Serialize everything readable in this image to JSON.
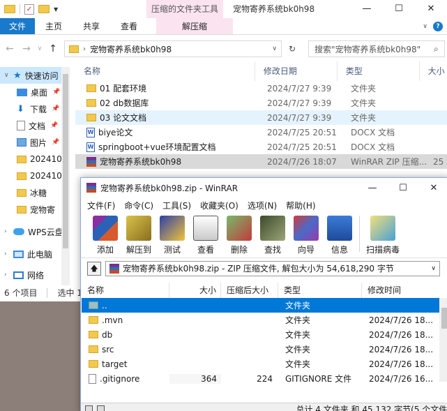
{
  "explorer": {
    "titlebar": {
      "context_tab_title": "压缩的文件夹工具",
      "window_title": "宠物寄养系统bk0h98",
      "minimize": "—",
      "maximize": "☐",
      "close": "✕"
    },
    "ribbon_tabs": [
      "文件",
      "主页",
      "共享",
      "查看",
      "解压缩"
    ],
    "address": {
      "path": "宠物寄养系统bk0h98",
      "search_placeholder": "搜索\"宠物寄养系统bk0h98\""
    },
    "nav": [
      {
        "label": "快速访问"
      },
      {
        "label": "桌面"
      },
      {
        "label": "下载"
      },
      {
        "label": "文档"
      },
      {
        "label": "图片"
      },
      {
        "label": "202410"
      },
      {
        "label": "202410"
      },
      {
        "label": "冰糖"
      },
      {
        "label": "宠物寄"
      },
      {
        "label": "WPS云盘"
      },
      {
        "label": "此电脑"
      },
      {
        "label": "网络"
      }
    ],
    "columns": {
      "name": "名称",
      "date": "修改日期",
      "type": "类型",
      "size": "大小"
    },
    "files": [
      {
        "name": "01 配套环境",
        "date": "2024/7/27 9:39",
        "type": "文件夹",
        "size": ""
      },
      {
        "name": "02 db数据库",
        "date": "2024/7/27 9:39",
        "type": "文件夹",
        "size": ""
      },
      {
        "name": "03 论文文档",
        "date": "2024/7/27 9:39",
        "type": "文件夹",
        "size": ""
      },
      {
        "name": "biye论文",
        "date": "2024/7/25 20:51",
        "type": "DOCX 文档",
        "size": ""
      },
      {
        "name": "springboot+vue环境配置文档",
        "date": "2024/7/25 20:51",
        "type": "DOCX 文档",
        "size": ""
      },
      {
        "name": "宠物寄养系统bk0h98",
        "date": "2024/7/26 18:07",
        "type": "WinRAR ZIP 压缩...",
        "size": "25"
      }
    ],
    "status": {
      "count": "6 个项目",
      "selected": "选中 1"
    }
  },
  "winrar": {
    "title": "宠物寄养系统bk0h98.zip - WinRAR",
    "menu": [
      "文件(F)",
      "命令(C)",
      "工具(S)",
      "收藏夹(O)",
      "选项(N)",
      "帮助(H)"
    ],
    "toolbar": [
      "添加",
      "解压到",
      "测试",
      "查看",
      "删除",
      "查找",
      "向导",
      "信息",
      "扫描病毒"
    ],
    "path": "宠物寄养系统bk0h98.zip - ZIP 压缩文件, 解包大小为 54,618,290 字节",
    "columns": {
      "name": "名称",
      "size": "大小",
      "packed": "压缩后大小",
      "type": "类型",
      "modified": "修改时间"
    },
    "rows": [
      {
        "name": "..",
        "size": "",
        "packed": "",
        "type": "文件夹",
        "modified": ""
      },
      {
        "name": ".mvn",
        "size": "",
        "packed": "",
        "type": "文件夹",
        "modified": "2024/7/26 18..."
      },
      {
        "name": "db",
        "size": "",
        "packed": "",
        "type": "文件夹",
        "modified": "2024/7/26 18..."
      },
      {
        "name": "src",
        "size": "",
        "packed": "",
        "type": "文件夹",
        "modified": "2024/7/26 18..."
      },
      {
        "name": "target",
        "size": "",
        "packed": "",
        "type": "文件夹",
        "modified": "2024/7/26 18..."
      },
      {
        "name": ".gitignore",
        "size": "364",
        "packed": "224",
        "type": "GITIGNORE 文件",
        "modified": "2024/7/26 16..."
      }
    ],
    "status": "总计 4 文件夹 和 45,132 字节(5 个文件)"
  }
}
